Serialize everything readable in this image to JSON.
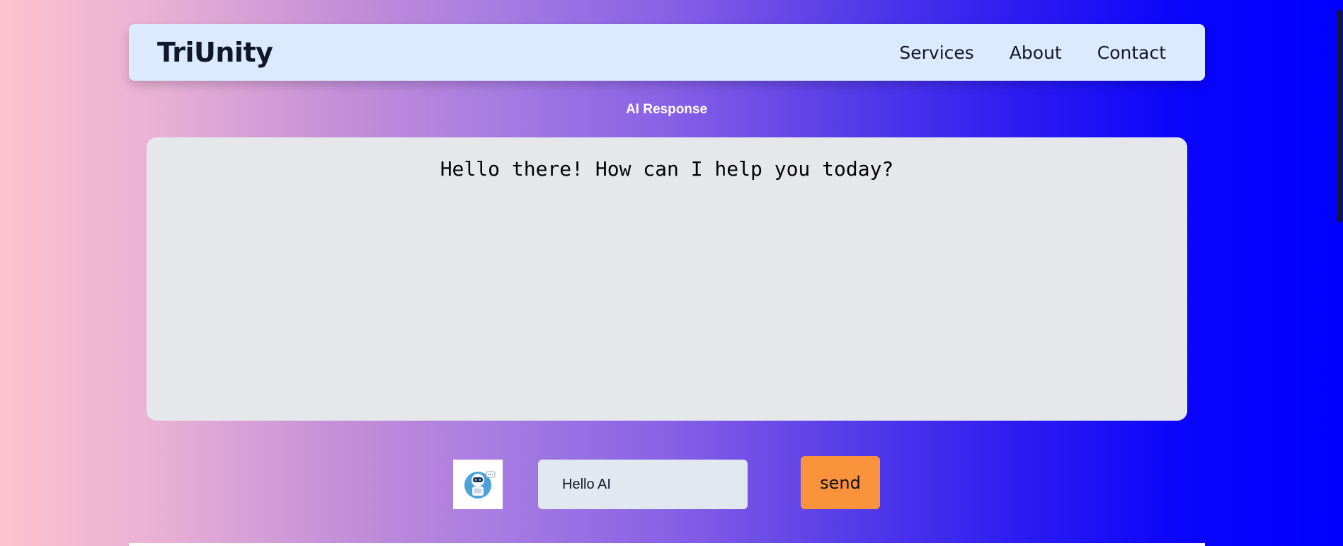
{
  "navbar": {
    "brand": "TriUnity",
    "links": [
      "Services",
      "About",
      "Contact"
    ]
  },
  "chat": {
    "section_title": "AI Response",
    "response_text": "Hello there! How can I help you today?",
    "avatar_icon": "robot-avatar-icon",
    "input_value": "Hello AI",
    "send_label": "send"
  },
  "colors": {
    "gradient_start": "#ffc2ce",
    "gradient_end": "#0000ff",
    "navbar_bg": "#dbeafe",
    "response_bg": "#e5e7eb",
    "input_bg": "#e2e8f0",
    "send_bg": "#fb923c"
  }
}
